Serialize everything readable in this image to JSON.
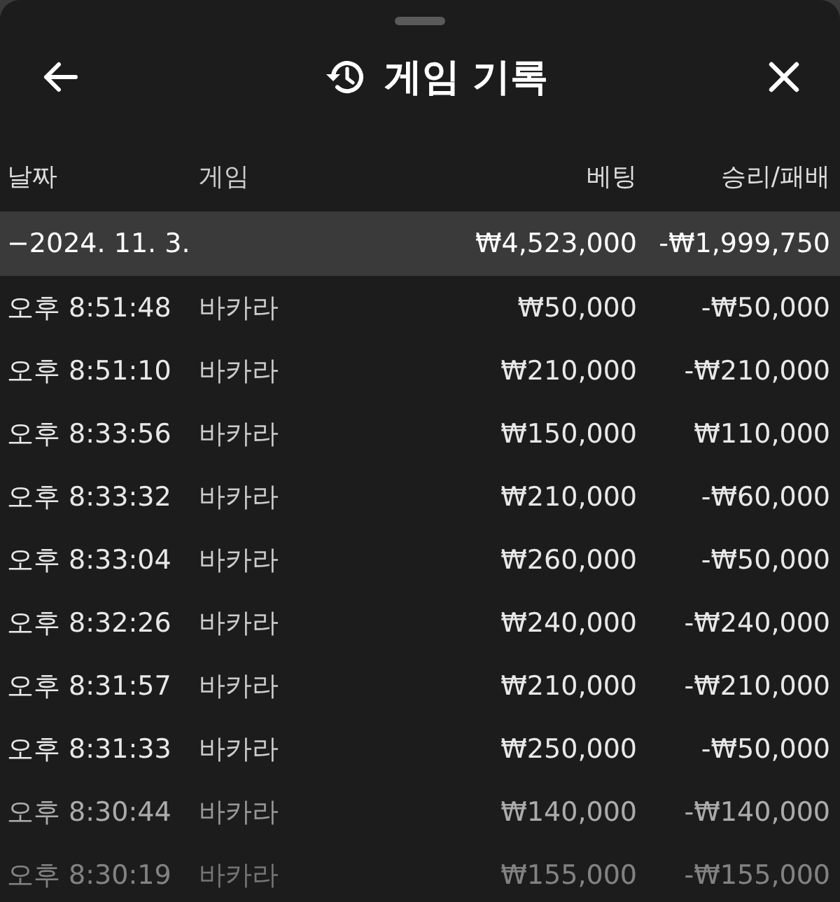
{
  "header": {
    "title": "게임 기록"
  },
  "table": {
    "columns": [
      "날짜",
      "게임",
      "베팅",
      "승리/패배"
    ],
    "group": {
      "date": "−2024. 11. 3.",
      "bet": "₩4,523,000",
      "result": "-₩1,999,750"
    },
    "rows": [
      {
        "time": "오후 8:51:48",
        "game": "바카라",
        "bet": "₩50,000",
        "result": "-₩50,000"
      },
      {
        "time": "오후 8:51:10",
        "game": "바카라",
        "bet": "₩210,000",
        "result": "-₩210,000"
      },
      {
        "time": "오후 8:33:56",
        "game": "바카라",
        "bet": "₩150,000",
        "result": "₩110,000"
      },
      {
        "time": "오후 8:33:32",
        "game": "바카라",
        "bet": "₩210,000",
        "result": "-₩60,000"
      },
      {
        "time": "오후 8:33:04",
        "game": "바카라",
        "bet": "₩260,000",
        "result": "-₩50,000"
      },
      {
        "time": "오후 8:32:26",
        "game": "바카라",
        "bet": "₩240,000",
        "result": "-₩240,000"
      },
      {
        "time": "오후 8:31:57",
        "game": "바카라",
        "bet": "₩210,000",
        "result": "-₩210,000"
      },
      {
        "time": "오후 8:31:33",
        "game": "바카라",
        "bet": "₩250,000",
        "result": "-₩50,000"
      },
      {
        "time": "오후 8:30:44",
        "game": "바카라",
        "bet": "₩140,000",
        "result": "-₩140,000"
      },
      {
        "time": "오후 8:30:19",
        "game": "바카라",
        "bet": "₩155,000",
        "result": "-₩155,000"
      }
    ]
  }
}
